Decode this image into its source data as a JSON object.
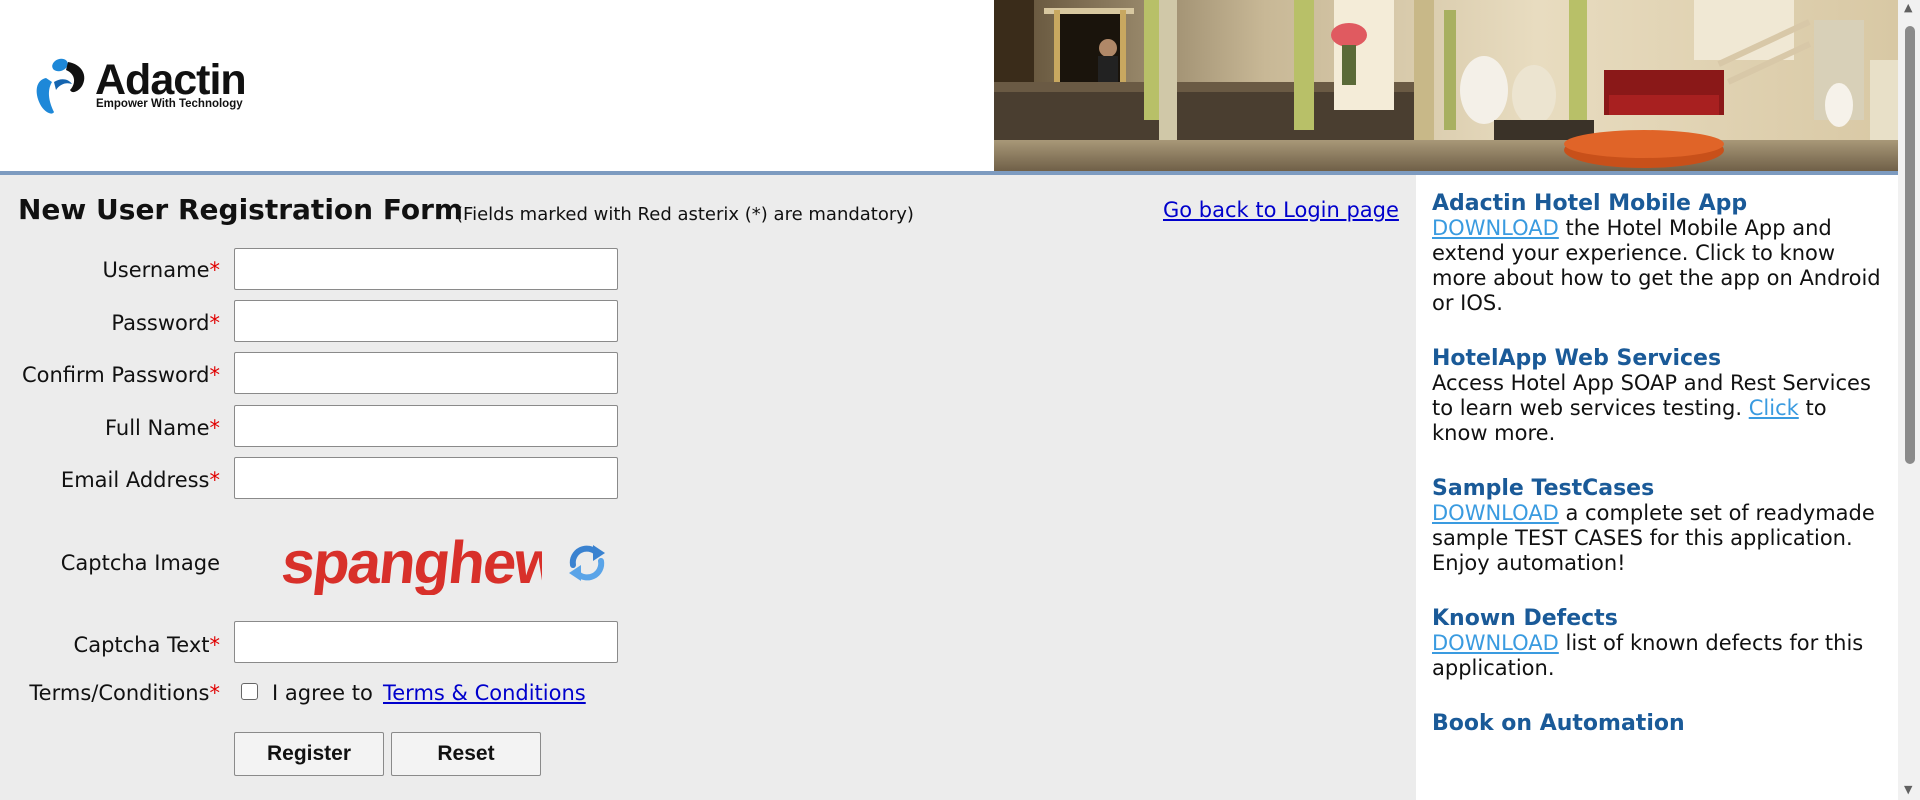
{
  "header": {
    "logo_name": "Adactin",
    "logo_tagline": "Empower With Technology",
    "banner_image": "hotel-lobby-banner"
  },
  "form": {
    "title": "New User Registration Form",
    "note": "(Fields marked with Red asterix (*) are mandatory)",
    "back_link": "Go back to Login page",
    "mandatory_marker": "*",
    "fields": {
      "username": {
        "label": "Username",
        "value": ""
      },
      "password": {
        "label": "Password",
        "value": ""
      },
      "confirm_password": {
        "label": "Confirm Password",
        "value": ""
      },
      "full_name": {
        "label": "Full Name",
        "value": ""
      },
      "email": {
        "label": "Email Address",
        "value": ""
      },
      "captcha_text": {
        "label": "Captcha Text",
        "value": ""
      }
    },
    "captcha": {
      "label": "Captcha Image",
      "text": "spanghew",
      "refresh_icon": "refresh-icon"
    },
    "terms": {
      "label": "Terms/Conditions",
      "agree_text": "I agree to",
      "link_text": "Terms & Conditions",
      "checked": false
    },
    "buttons": {
      "register": "Register",
      "reset": "Reset"
    }
  },
  "sidebar": {
    "mobile": {
      "title": "Adactin Hotel Mobile App",
      "link": "DOWNLOAD",
      "text": " the Hotel Mobile App and extend your experience. Click to know more about how to get the app on Android or IOS."
    },
    "webservices": {
      "title": "HotelApp Web Services",
      "text_before": "Access Hotel App SOAP and Rest Services to learn web services testing. ",
      "link": "Click",
      "text_after": " to know more."
    },
    "testcases": {
      "title": "Sample TestCases",
      "link": "DOWNLOAD",
      "text": " a complete set of readymade sample TEST CASES for this application. Enjoy automation!"
    },
    "defects": {
      "title": "Known Defects",
      "link": "DOWNLOAD",
      "text": " list of known defects for this application."
    },
    "book": {
      "title": "Book on Automation"
    }
  },
  "colors": {
    "accent_blue": "#1a5a98",
    "link_blue": "#0000cc",
    "light_link": "#3a9be0",
    "mandatory_red": "#e00000",
    "header_rule": "#7d9bc0",
    "form_bg": "#ececec"
  }
}
